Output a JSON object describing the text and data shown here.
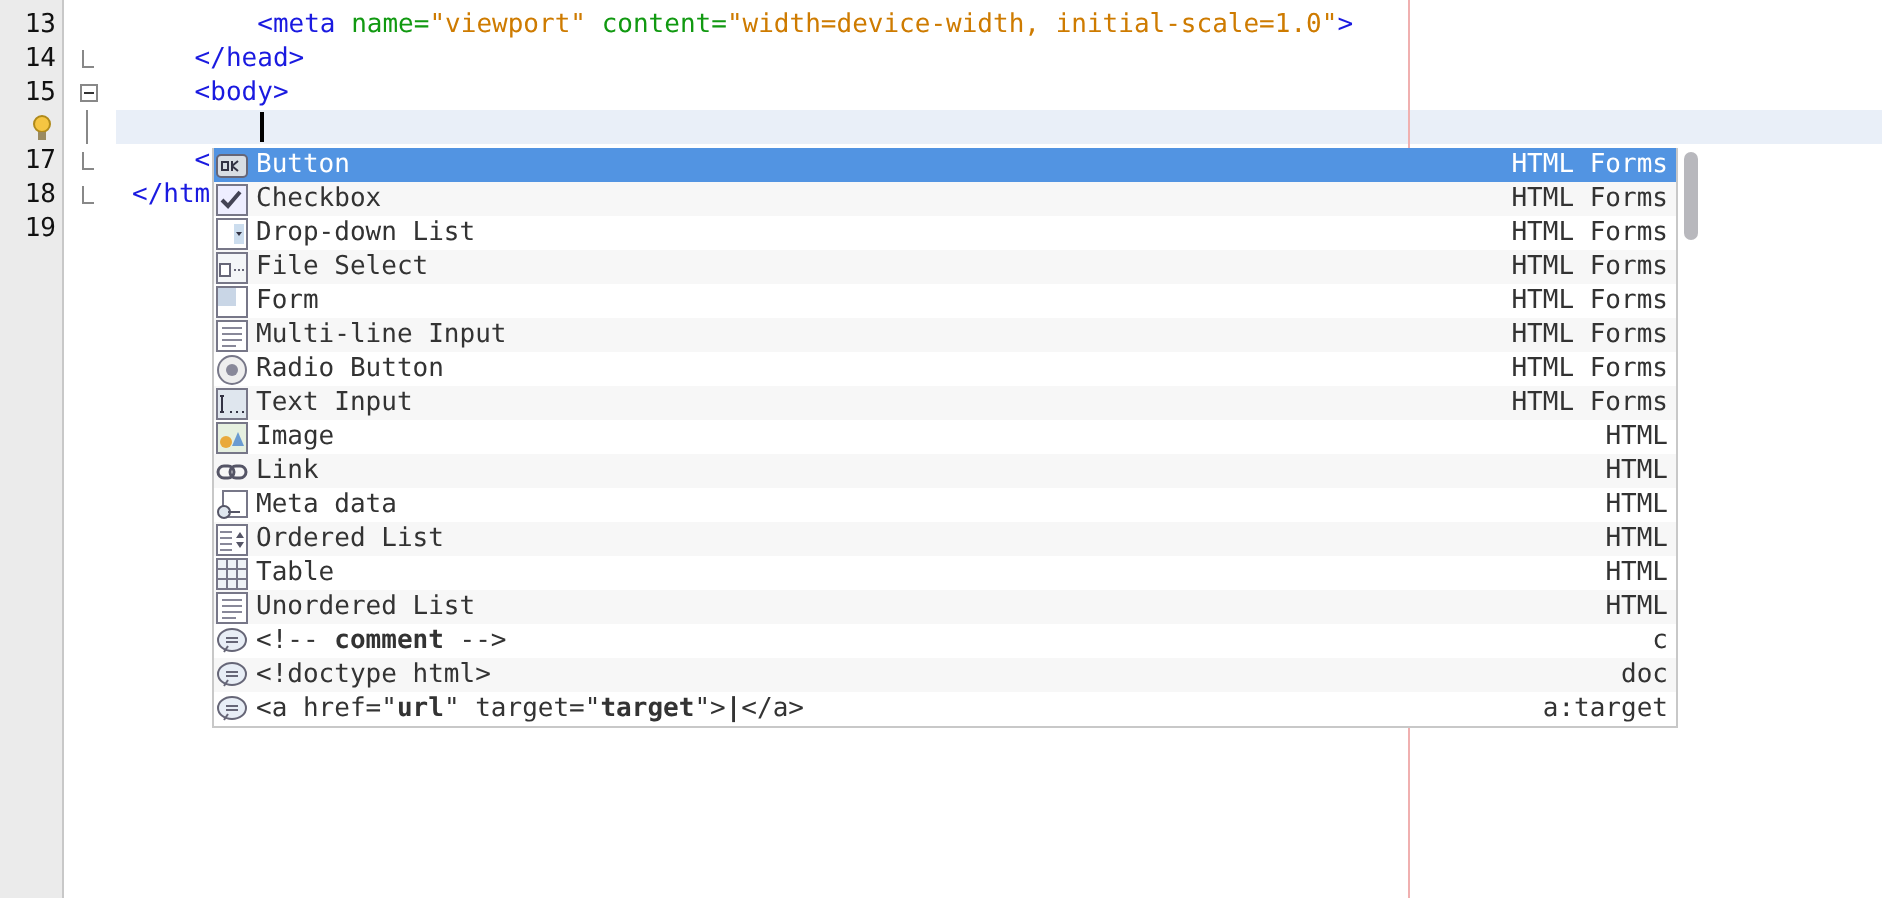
{
  "editor": {
    "lines": [
      {
        "number": "13",
        "kind": "plain",
        "current": false,
        "tokens": [
          {
            "kind": "tag",
            "text": "        <meta "
          },
          {
            "kind": "attr",
            "text": "name="
          },
          {
            "kind": "value",
            "text": "\"viewport\""
          },
          {
            "kind": "attr",
            "text": " content="
          },
          {
            "kind": "value",
            "text": "\"width=device-width, initial-scale=1.0\""
          },
          {
            "kind": "tag",
            "text": ">"
          }
        ]
      },
      {
        "number": "14",
        "kind": "fold-end",
        "current": false,
        "tokens": [
          {
            "kind": "tag",
            "text": "    </head>"
          }
        ]
      },
      {
        "number": "15",
        "kind": "fold-start",
        "current": false,
        "tokens": [
          {
            "kind": "tag",
            "text": "    <body>"
          }
        ]
      },
      {
        "kind": "fold-line",
        "current": true,
        "hint": true
      },
      {
        "number": "17",
        "kind": "fold-end",
        "current": false,
        "tokens": [
          {
            "kind": "tag",
            "text": "    <"
          }
        ]
      },
      {
        "number": "18",
        "kind": "fold-end",
        "current": false,
        "tokens": [
          {
            "kind": "tag",
            "text": "</htm"
          }
        ]
      },
      {
        "number": "19",
        "kind": "plain",
        "current": false
      }
    ]
  },
  "completion": {
    "items": [
      {
        "kind": "button",
        "label": "Button",
        "category": "HTML Forms",
        "selected": true
      },
      {
        "kind": "checkbox",
        "label": "Checkbox",
        "category": "HTML Forms",
        "selected": false
      },
      {
        "kind": "dropdown",
        "label": "Drop-down List",
        "category": "HTML Forms",
        "selected": false
      },
      {
        "kind": "file",
        "label": "File Select",
        "category": "HTML Forms",
        "selected": false
      },
      {
        "kind": "form",
        "label": "Form",
        "category": "HTML Forms",
        "selected": false
      },
      {
        "kind": "textarea",
        "label": "Multi-line Input",
        "category": "HTML Forms",
        "selected": false
      },
      {
        "kind": "radio",
        "label": "Radio Button",
        "category": "HTML Forms",
        "selected": false
      },
      {
        "kind": "textinput",
        "label": "Text Input",
        "category": "HTML Forms",
        "selected": false
      },
      {
        "kind": "image",
        "label": "Image",
        "category": "HTML",
        "selected": false
      },
      {
        "kind": "link",
        "label": "Link",
        "category": "HTML",
        "selected": false
      },
      {
        "kind": "meta",
        "label": "Meta data",
        "category": "HTML",
        "selected": false
      },
      {
        "kind": "ol",
        "label": "Ordered List",
        "category": "HTML",
        "selected": false
      },
      {
        "kind": "table",
        "label": "Table",
        "category": "HTML",
        "selected": false
      },
      {
        "kind": "ul",
        "label": "Unordered List",
        "category": "HTML",
        "selected": false
      },
      {
        "kind": "snippet",
        "label": "<!-- **comment** -->",
        "category": "c",
        "selected": false
      },
      {
        "kind": "snippet",
        "label": "<!doctype html>",
        "category": "doc",
        "selected": false
      },
      {
        "kind": "snippet",
        "label": "<a href=\"**url**\" target=\"**target**\">**|**</a>",
        "category": "a:target",
        "selected": false
      }
    ]
  }
}
